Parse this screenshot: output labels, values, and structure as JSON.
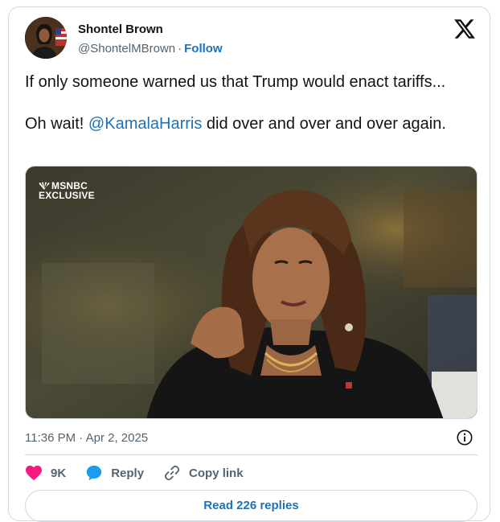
{
  "author": {
    "name": "Shontel Brown",
    "handle": "@ShontelMBrown",
    "separator": "·",
    "follow_label": "Follow"
  },
  "tweet": {
    "line1": "If only someone warned us that Trump would enact tariffs...",
    "line2_prefix": "Oh wait! ",
    "mention": "@KamalaHarris",
    "line2_suffix": " did over and over and over again."
  },
  "media": {
    "badge_line1": "MSNBC",
    "badge_line2": "EXCLUSIVE"
  },
  "meta": {
    "timestamp": "11:36 PM · Apr 2, 2025"
  },
  "actions": {
    "likes_count": "9K",
    "reply_label": "Reply",
    "copy_link_label": "Copy link"
  },
  "read_replies_label": "Read 226 replies",
  "icons": {
    "platform": "x-logo-icon",
    "like": "heart-icon",
    "reply": "speech-bubble-icon",
    "copy": "link-icon",
    "info": "info-icon"
  },
  "colors": {
    "link": "#1d72b8",
    "like": "#f91880",
    "reply": "#1d9bf0",
    "muted": "#536471"
  }
}
